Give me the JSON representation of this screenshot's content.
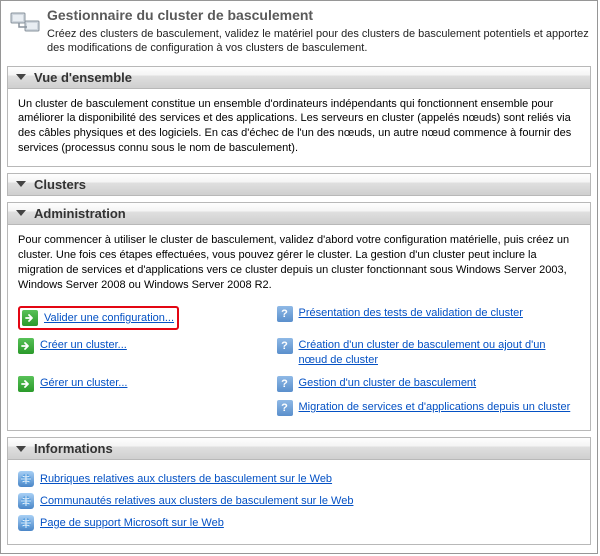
{
  "header": {
    "title": "Gestionnaire du cluster de basculement",
    "subtitle": "Créez des clusters de basculement, validez le matériel pour des clusters de basculement potentiels et apportez des modifications de configuration à vos clusters de basculement."
  },
  "overview": {
    "heading": "Vue d'ensemble",
    "text": "Un cluster de basculement constitue un ensemble d'ordinateurs indépendants qui fonctionnent ensemble pour améliorer la disponibilité des services et des applications. Les serveurs en cluster (appelés nœuds) sont reliés via des câbles physiques et des logiciels. En cas d'échec de l'un des nœuds, un autre nœud commence à fournir des services (processus connu sous le nom de basculement)."
  },
  "clusters": {
    "heading": "Clusters"
  },
  "admin": {
    "heading": "Administration",
    "intro": "Pour commencer à utiliser le cluster de basculement, validez d'abord votre configuration matérielle, puis créez un cluster. Une fois ces étapes effectuées, vous pouvez gérer le cluster. La gestion d'un cluster peut inclure la migration de services et d'applications vers ce cluster depuis un cluster fonctionnant sous Windows Server 2003, Windows Server 2008 ou Windows Server 2008 R2.",
    "actions": {
      "validate": "Valider une configuration...",
      "create": "Créer un cluster...",
      "manage": "Gérer un cluster..."
    },
    "help": {
      "tests": "Présentation des tests de validation de cluster",
      "createHelp": "Création d'un cluster de basculement ou ajout d'un nœud de cluster",
      "manageHelp": "Gestion d'un cluster de basculement",
      "migrate": "Migration de services et d'applications depuis un cluster"
    }
  },
  "info": {
    "heading": "Informations",
    "links": {
      "topics": "Rubriques relatives aux clusters de basculement sur le Web",
      "communities": "Communautés relatives aux clusters de basculement sur le Web",
      "support": "Page de support Microsoft sur le Web"
    }
  }
}
